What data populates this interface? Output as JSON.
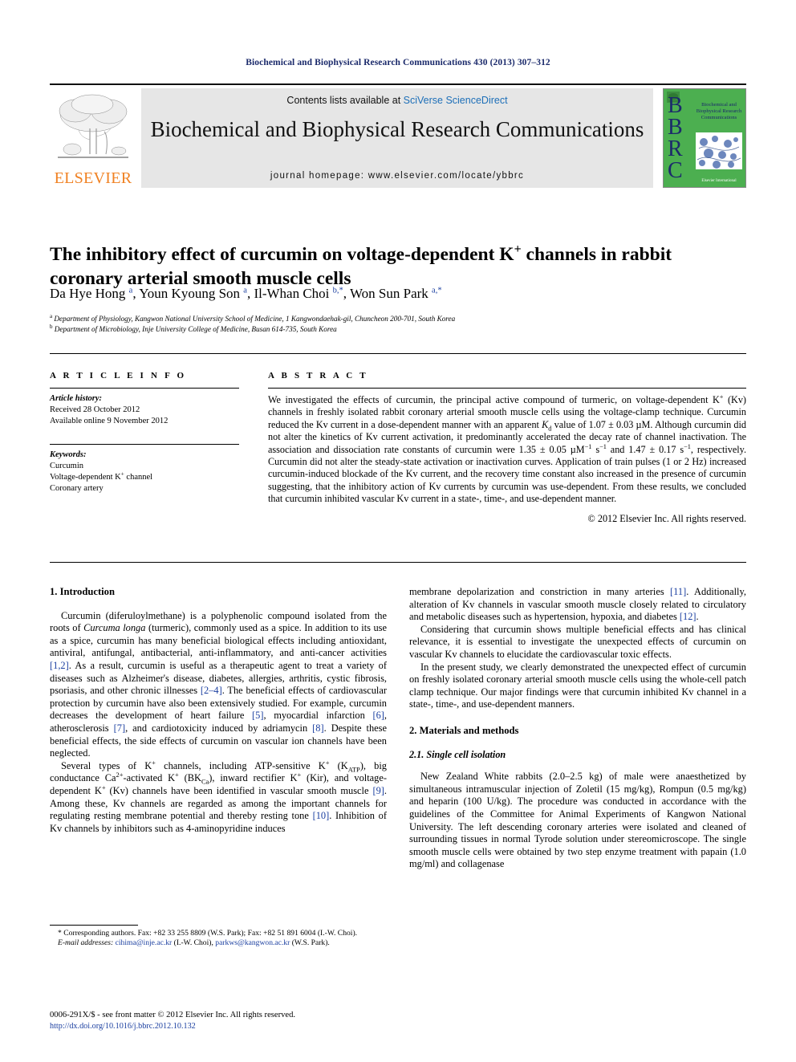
{
  "running_head": "Biochemical and Biophysical Research Communications 430 (2013) 307–312",
  "masthead": {
    "contents_prefix": "Contents lists available at ",
    "contents_link": "SciVerse ScienceDirect",
    "journal_title": "Biochemical and Biophysical Research Communications",
    "homepage": "journal homepage: www.elsevier.com/locate/ybbrc",
    "elsevier_wordmark": "ELSEVIER",
    "cover_letters": "BBRC",
    "cover_title": "Biochemical and Biophysical Research Communications",
    "cover_footer": "Elsevier International",
    "accent_link_color": "#1d6fb8",
    "elsevier_orange": "#F08122",
    "cover_green": "#4caf50",
    "cover_navy": "#1b2a6b"
  },
  "article": {
    "title": "The inhibitory effect of curcumin on voltage-dependent K+ channels in rabbit coronary arterial smooth muscle cells",
    "authors": "Da Hye Hong a, Youn Kyoung Son a, Il-Whan Choi b,*, Won Sun Park a,*",
    "affiliation_a": "Department of Physiology, Kangwon National University School of Medicine, 1 Kangwondaehak-gil, Chuncheon 200-701, South Korea",
    "affiliation_b": "Department of Microbiology, Inje University College of Medicine, Busan 614-735, South Korea"
  },
  "article_info": {
    "section_label": "A R T I C L E   I N F O",
    "history_heading": "Article history:",
    "history_lines": [
      "Received 28 October 2012",
      "Available online 9 November 2012"
    ],
    "keywords_heading": "Keywords:",
    "keywords": [
      "Curcumin",
      "Voltage-dependent K+ channel",
      "Coronary artery"
    ]
  },
  "abstract": {
    "section_label": "A B S T R A C T",
    "body": "We investigated the effects of curcumin, the principal active compound of turmeric, on voltage-dependent K+ (Kv) channels in freshly isolated rabbit coronary arterial smooth muscle cells using the voltage-clamp technique. Curcumin reduced the Kv current in a dose-dependent manner with an apparent Kd value of 1.07 ± 0.03 µM. Although curcumin did not alter the kinetics of Kv current activation, it predominantly accelerated the decay rate of channel inactivation. The association and dissociation rate constants of curcumin were 1.35 ± 0.05 µM−1 s−1 and 1.47 ± 0.17 s−1, respectively. Curcumin did not alter the steady-state activation or inactivation curves. Application of train pulses (1 or 2 Hz) increased curcumin-induced blockade of the Kv current, and the recovery time constant also increased in the presence of curcumin suggesting, that the inhibitory action of Kv currents by curcumin was use-dependent. From these results, we concluded that curcumin inhibited vascular Kv current in a state-, time-, and use-dependent manner.",
    "copyright": "© 2012 Elsevier Inc. All rights reserved."
  },
  "body": {
    "intro_heading": "1. Introduction",
    "intro_p1": "Curcumin (diferuloylmethane) is a polyphenolic compound isolated from the roots of Curcuma longa (turmeric), commonly used as a spice. In addition to its use as a spice, curcumin has many beneficial biological effects including antioxidant, antiviral, antifungal, antibacterial, anti-inflammatory, and anti-cancer activities [1,2]. As a result, curcumin is useful as a therapeutic agent to treat a variety of diseases such as Alzheimer's disease, diabetes, allergies, arthritis, cystic fibrosis, psoriasis, and other chronic illnesses [2–4]. The beneficial effects of cardiovascular protection by curcumin have also been extensively studied. For example, curcumin decreases the development of heart failure [5], myocardial infarction [6], atherosclerosis [7], and cardiotoxicity induced by adriamycin [8]. Despite these beneficial effects, the side effects of curcumin on vascular ion channels have been neglected.",
    "intro_p2": "Several types of K+ channels, including ATP-sensitive K+ (KATP), big conductance Ca2+-activated K+ (BKCa), inward rectifier K+ (Kir), and voltage-dependent K+ (Kv) channels have been identified in vascular smooth muscle [9]. Among these, Kv channels are regarded as among the important channels for regulating resting membrane potential and thereby resting tone [10]. Inhibition of Kv channels by inhibitors such as 4-aminopyridine induces",
    "intro_p3": "membrane depolarization and constriction in many arteries [11]. Additionally, alteration of Kv channels in vascular smooth muscle closely related to circulatory and metabolic diseases such as hypertension, hypoxia, and diabetes [12].",
    "intro_p4": "Considering that curcumin shows multiple beneficial effects and has clinical relevance, it is essential to investigate the unexpected effects of curcumin on vascular Kv channels to elucidate the cardiovascular toxic effects.",
    "intro_p5": "In the present study, we clearly demonstrated the unexpected effect of curcumin on freshly isolated coronary arterial smooth muscle cells using the whole-cell patch clamp technique. Our major findings were that curcumin inhibited Kv channel in a state-, time-, and use-dependent manners.",
    "methods_heading": "2. Materials and methods",
    "methods_sub_heading": "2.1. Single cell isolation",
    "methods_p1": "New Zealand White rabbits (2.0–2.5 kg) of male were anaesthetized by simultaneous intramuscular injection of Zoletil (15 mg/kg), Rompun (0.5 mg/kg) and heparin (100 U/kg). The procedure was conducted in accordance with the guidelines of the Committee for Animal Experiments of Kangwon National University. The left descending coronary arteries were isolated and cleaned of surrounding tissues in normal Tyrode solution under stereomicroscope. The single smooth muscle cells were obtained by two step enzyme treatment with papain (1.0 mg/ml) and collagenase"
  },
  "footnotes": {
    "corresponding": "* Corresponding authors. Fax: +82 33 255 8809 (W.S. Park); Fax: +82 51 891 6004 (I.-W. Choi).",
    "email_label": "E-mail addresses:",
    "email_1": "cihima@inje.ac.kr",
    "email_1_owner": "(I.-W. Choi),",
    "email_2": "parkws@kangwon.ac.kr",
    "email_2_owner": "(W.S. Park).",
    "front_matter": "0006-291X/$ - see front matter © 2012 Elsevier Inc. All rights reserved.",
    "doi": "http://dx.doi.org/10.1016/j.bbrc.2012.10.132"
  }
}
